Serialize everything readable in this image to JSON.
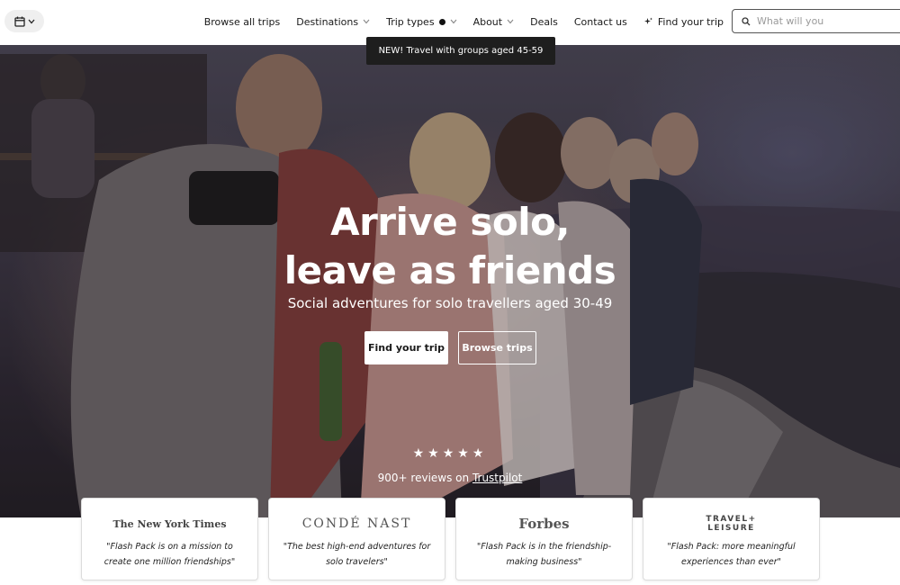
{
  "nav": {
    "calendar_icon": "calendar-icon",
    "items": [
      {
        "label": "Browse all trips",
        "dropdown": false
      },
      {
        "label": "Destinations",
        "dropdown": true
      },
      {
        "label": "Trip types",
        "dropdown": true
      },
      {
        "label": "About",
        "dropdown": true
      },
      {
        "label": "Deals",
        "dropdown": false
      },
      {
        "label": "Contact us",
        "dropdown": false
      },
      {
        "label": "Find your trip",
        "dropdown": false,
        "icon": "sparkle-icon"
      }
    ],
    "search_placeholder": "What will you"
  },
  "tooltip": {
    "text": "NEW! Travel with groups aged 45-59"
  },
  "hero": {
    "headline_line1": "Arrive solo,",
    "headline_line2": "leave as friends",
    "subheadline": "Social adventures for solo travellers aged 30-49",
    "primary_button": "Find your trip",
    "secondary_button": "Browse trips",
    "stars": "★★★★★",
    "reviews_text": "900+ reviews on",
    "reviews_link": "Trustpilot"
  },
  "press": [
    {
      "logo": "The New York Times",
      "quote": "\"Flash Pack is on a mission to create one million friendships\""
    },
    {
      "logo": "CONDÉ NAST",
      "quote": "\"The best high-end adventures for solo travelers\""
    },
    {
      "logo": "Forbes",
      "quote": "\"Flash Pack is in the friendship-making business\""
    },
    {
      "logo_line1": "TRAVEL+",
      "logo_line2": "LEISURE",
      "quote": "\"Flash Pack: more meaningful experiences than ever\""
    }
  ],
  "colors": {
    "accent": "#ffffff",
    "nav_bg": "#ffffff",
    "tooltip_bg": "#1e1e1e"
  }
}
